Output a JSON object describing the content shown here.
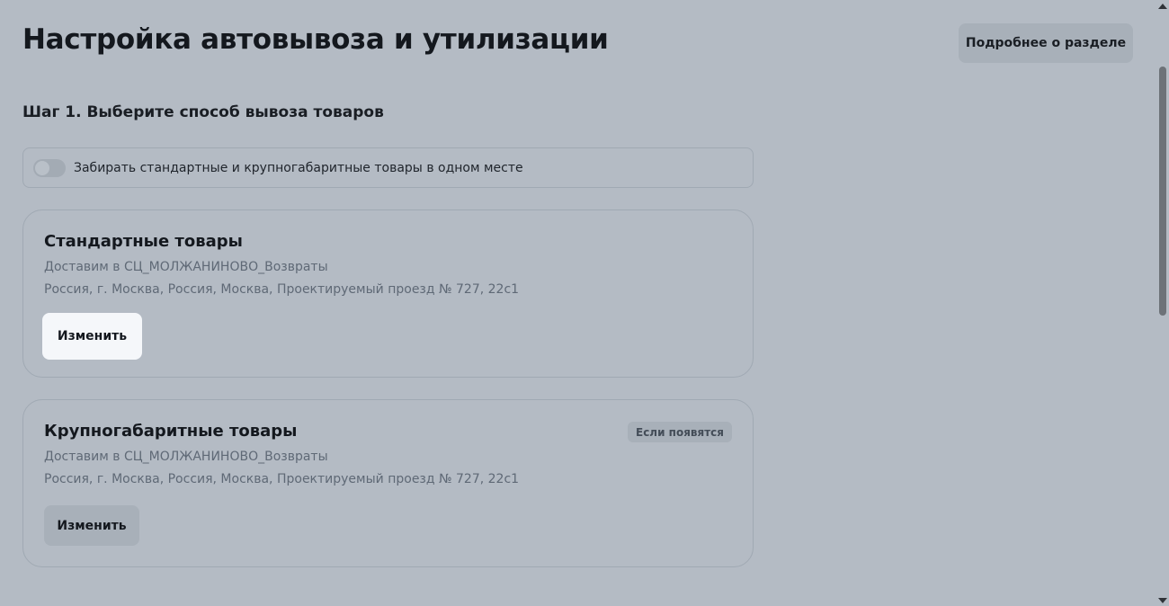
{
  "page": {
    "title": "Настройка автовывоза и утилизации",
    "more_button_label": "Подробнее о разделе"
  },
  "step1": {
    "title": "Шаг 1. Выберите способ вывоза товаров",
    "toggle_label": "Забирать стандартные и крупногабаритные товары в одном месте",
    "toggle_on": false
  },
  "cards": [
    {
      "title": "Стандартные товары",
      "delivery": "Доставим в СЦ_МОЛЖАНИНОВО_Возвраты",
      "address": "Россия, г. Москва, Россия, Москва, Проектируемый проезд № 727, 22с1",
      "button_label": "Изменить",
      "badge": ""
    },
    {
      "title": "Крупногабаритные товары",
      "delivery": "Доставим в СЦ_МОЛЖАНИНОВО_Возвраты",
      "address": "Россия, г. Москва, Россия, Москва, Проектируемый проезд № 727, 22с1",
      "button_label": "Изменить",
      "badge": "Если появятся"
    }
  ],
  "colors": {
    "overlay_background": "#b4bbc4",
    "highlight_button": "#f5f7fa"
  }
}
